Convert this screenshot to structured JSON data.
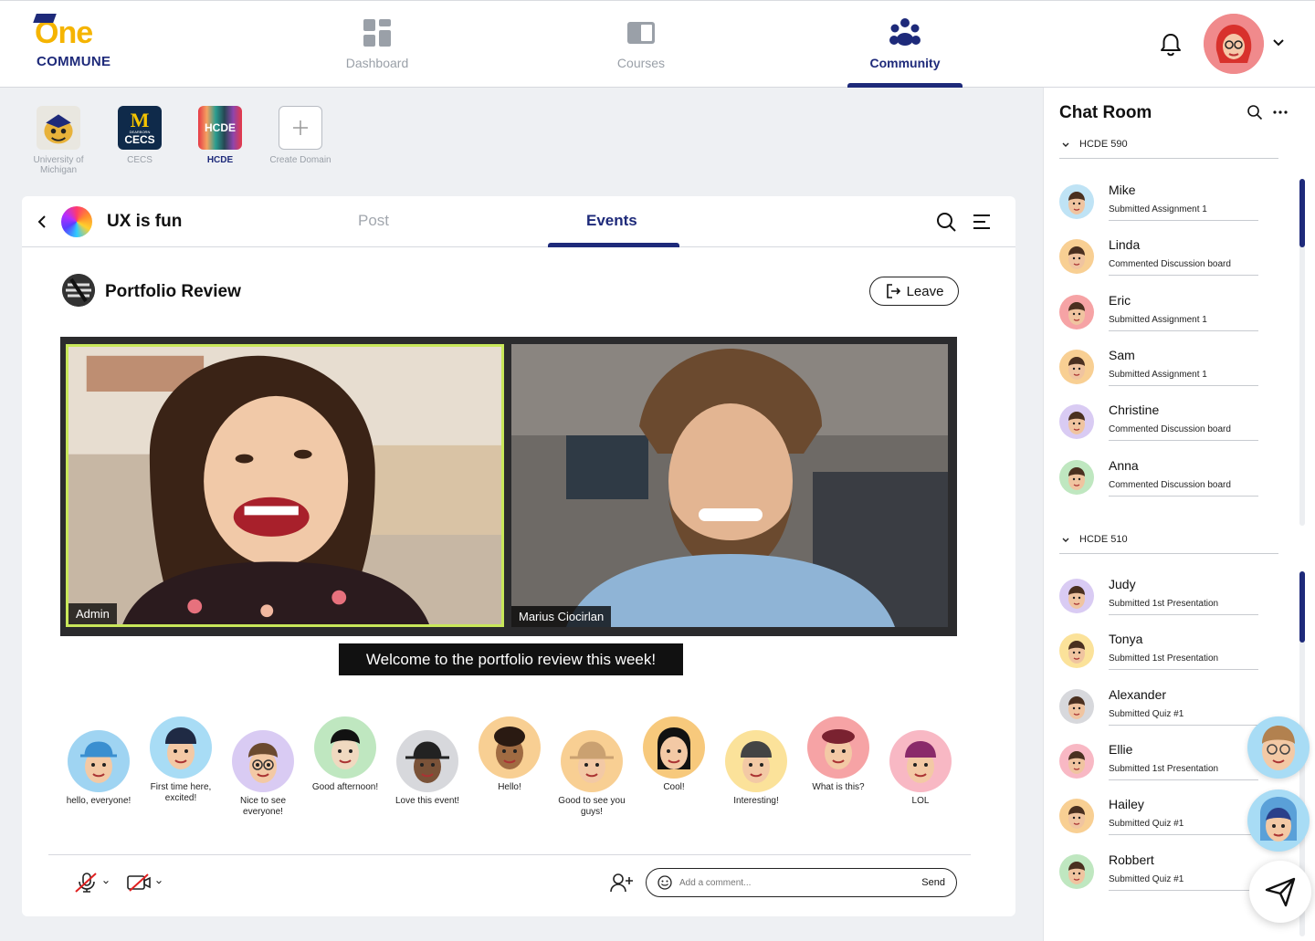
{
  "brand": {
    "logo_main": "One",
    "logo_sub": "COMMUNE"
  },
  "nav": {
    "items": [
      {
        "label": "Dashboard",
        "icon": "grid-icon",
        "active": false
      },
      {
        "label": "Courses",
        "icon": "book-icon",
        "active": false
      },
      {
        "label": "Community",
        "icon": "people-icon",
        "active": true
      }
    ]
  },
  "domains": [
    {
      "label": "University of Michigan",
      "active": false
    },
    {
      "label": "CECS",
      "tile_text_top": "M",
      "tile_text_small": "DEARBORN",
      "tile_text_bottom": "CECS",
      "active": false
    },
    {
      "label": "HCDE",
      "tile_text": "HCDE",
      "active": true
    },
    {
      "label": "Create Domain",
      "active": false
    }
  ],
  "group": {
    "title": "UX is fun",
    "tabs": [
      {
        "label": "Post",
        "active": false
      },
      {
        "label": "Events",
        "active": true
      }
    ]
  },
  "event": {
    "title": "Portfolio Review",
    "leave_label": "Leave",
    "video_tiles": [
      {
        "name": "Admin",
        "speaking": true
      },
      {
        "name": "Marius Ciocirlan",
        "speaking": false
      }
    ],
    "caption": "Welcome to the portfolio review this week!"
  },
  "reactions": [
    {
      "text": "hello, everyone!",
      "bg": "#9fd4f2"
    },
    {
      "text": "First time here, excited!",
      "bg": "#a8dcf5"
    },
    {
      "text": "Nice to see everyone!",
      "bg": "#d9cbf3"
    },
    {
      "text": "Good afternoon!",
      "bg": "#bfe7c0"
    },
    {
      "text": "Love this event!",
      "bg": "#d7d8dc"
    },
    {
      "text": "Hello!",
      "bg": "#f8cf93"
    },
    {
      "text": "Good to see you guys!",
      "bg": "#f8cf93"
    },
    {
      "text": "Cool!",
      "bg": "#f7c97c"
    },
    {
      "text": "Interesting!",
      "bg": "#fbe29a"
    },
    {
      "text": "What is this?",
      "bg": "#f6a3a5"
    },
    {
      "text": "LOL",
      "bg": "#f8b8c4"
    }
  ],
  "composer": {
    "placeholder": "Add a comment...",
    "send_label": "Send"
  },
  "chat": {
    "title": "Chat Room",
    "groups": [
      {
        "label": "HCDE 590",
        "members": [
          {
            "name": "Mike",
            "activity": "Submitted Assignment 1",
            "bg": "#bfe3f5"
          },
          {
            "name": "Linda",
            "activity": "Commented Discussion board",
            "bg": "#f8cf93"
          },
          {
            "name": "Eric",
            "activity": "Submitted Assignment 1",
            "bg": "#f6a3a5"
          },
          {
            "name": "Sam",
            "activity": "Submitted Assignment 1",
            "bg": "#f8cf93"
          },
          {
            "name": "Christine",
            "activity": "Commented Discussion board",
            "bg": "#d9cbf3"
          },
          {
            "name": "Anna",
            "activity": "Commented Discussion board",
            "bg": "#bfe7c0"
          }
        ]
      },
      {
        "label": "HCDE 510",
        "members": [
          {
            "name": "Judy",
            "activity": "Submitted 1st Presentation",
            "bg": "#d9cbf3"
          },
          {
            "name": "Tonya",
            "activity": "Submitted 1st Presentation",
            "bg": "#fbe29a"
          },
          {
            "name": "Alexander",
            "activity": "Submitted Quiz #1",
            "bg": "#d7d8dc"
          },
          {
            "name": "Ellie",
            "activity": "Submitted 1st Presentation",
            "bg": "#f8b8c4"
          },
          {
            "name": "Hailey",
            "activity": "Submitted Quiz #1",
            "bg": "#f8cf93"
          },
          {
            "name": "Robbert",
            "activity": "Submitted Quiz #1",
            "bg": "#bfe7c0"
          }
        ]
      }
    ]
  },
  "colors": {
    "accent": "#1e2a7a",
    "brand_yellow": "#f5b400",
    "speaking_border": "#c9e85a"
  }
}
